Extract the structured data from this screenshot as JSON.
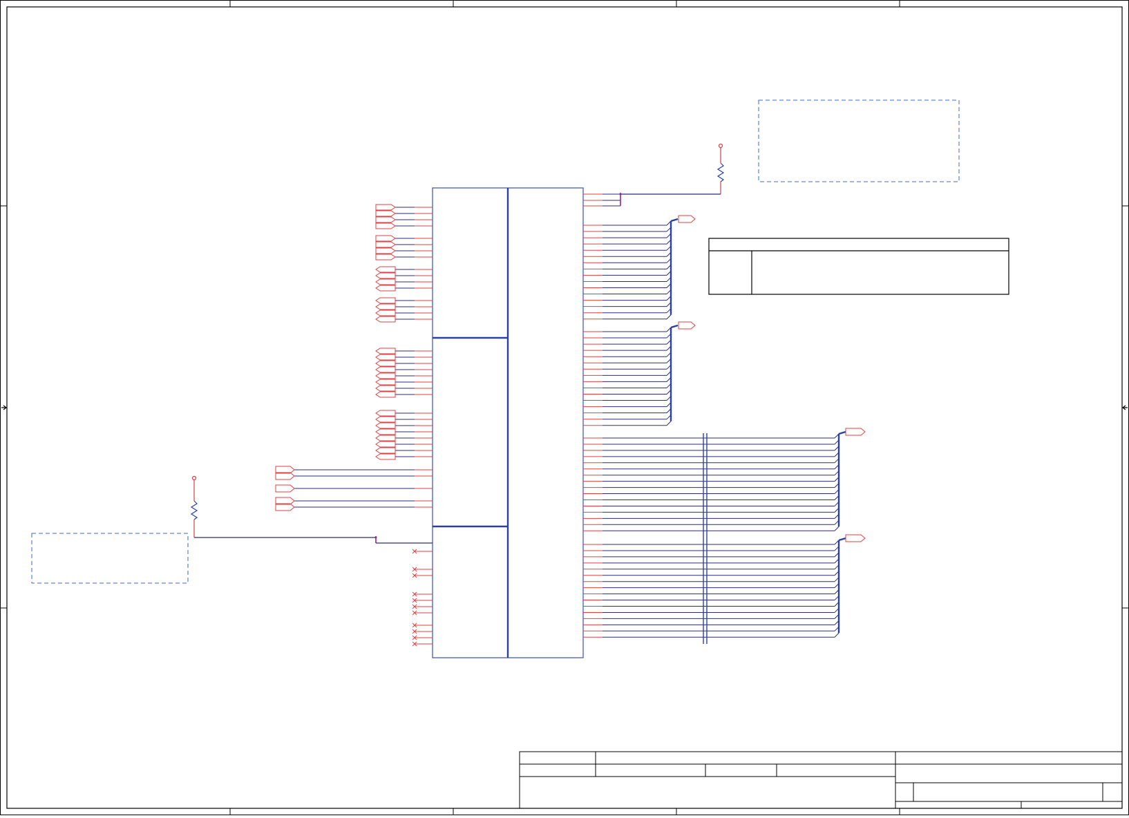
{
  "colors": {
    "frame": "#000000",
    "component": "#3a4fb0",
    "wire": "#2a2a7a",
    "pin": "#e04040",
    "port": "#e04040",
    "note_box": "#3a6ad0",
    "power": "#d04040"
  },
  "title_block": {},
  "note_table": {},
  "annotations": {}
}
